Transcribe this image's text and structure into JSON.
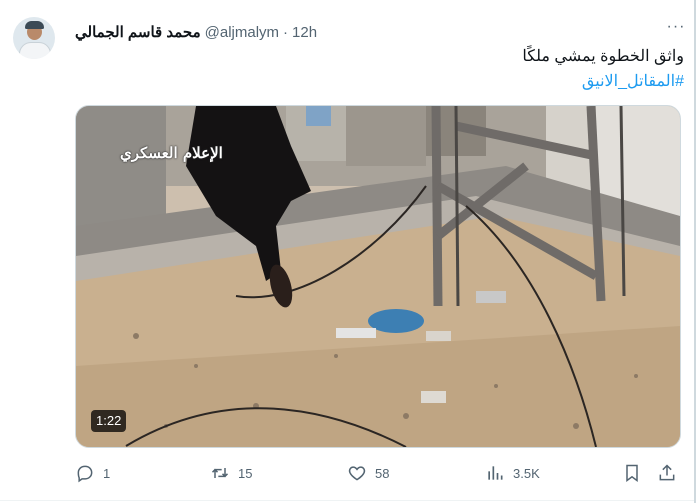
{
  "tweet": {
    "author": {
      "display_name": "محمد قاسم الجمالي",
      "handle": "@aljmalym",
      "separator": "·",
      "time": "12h",
      "avatar": "avatar-icon"
    },
    "text": "واثق الخطوة يمشي ملكًا",
    "hashtag": "#المقاتل_الانيق",
    "media": {
      "type": "video",
      "duration": "1:22",
      "watermark": "الإعلام العسكري"
    },
    "actions": {
      "reply": {
        "icon": "reply-icon",
        "count": "1"
      },
      "retweet": {
        "icon": "retweet-icon",
        "count": "15"
      },
      "like": {
        "icon": "like-icon",
        "count": "58"
      },
      "views": {
        "icon": "views-icon",
        "count": "3.5K"
      },
      "bookmark": {
        "icon": "bookmark-icon"
      },
      "share": {
        "icon": "share-icon"
      }
    },
    "more": {
      "icon": "more-icon",
      "label": "···"
    }
  },
  "colors": {
    "text": "#0f1419",
    "secondary": "#536471",
    "link": "#1d9bf0",
    "border": "#cfd9de"
  }
}
